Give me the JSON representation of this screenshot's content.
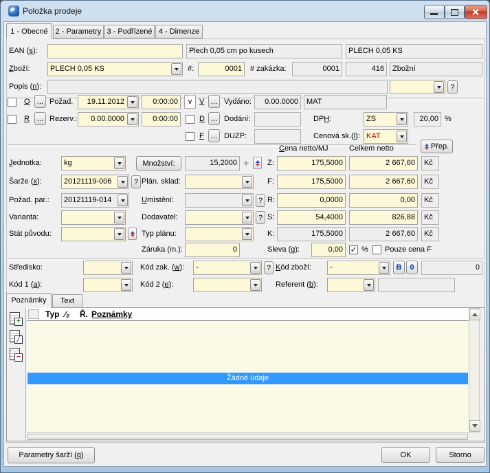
{
  "window": {
    "title": "Položka prodeje"
  },
  "colors": {
    "selection": "#3399ff",
    "alert_red": "#cc0000",
    "link_blue": "#0033aa",
    "field_yellow": "#fdf9d8"
  },
  "tabs": {
    "tab1": "1 - Obecné",
    "tab2": "2 - Parametry",
    "tab3": "3 - Podřízené",
    "tab4": "4 - Dimenze"
  },
  "misc": {
    "dots": "...",
    "question": "?",
    "plus": "+",
    "check_glyph": "✓"
  },
  "top": {
    "ean_label": "EAN (*s*):",
    "ean_value": "",
    "name_full": "Plech 0,05 cm po kusech",
    "name_code": "PLECH 0,05 KS",
    "zbozi_label": "*Z*boží:",
    "zbozi_value": "PLECH 0,05 KS",
    "hash_label": "#:",
    "hash_value": "0001",
    "zakazka_label": "# zakázka:",
    "zakazka_value": "0001",
    "zakazka_num": "416",
    "zakazka_type": "Zbožní",
    "popis_label": "Popis (*n*):",
    "popis_value": "",
    "popis_combo": ""
  },
  "dates": {
    "o_letter": "*O*",
    "o_label": "Požad.",
    "o_date": "19.11.2012",
    "o_time": "0:00:00",
    "r_letter": "*R*",
    "r_label": "Rezerv.:",
    "r_date": "0.00.0000",
    "r_time": "0:00:00",
    "v_flag": "v",
    "v_letter": "*V*",
    "v_label": "Vydáno:",
    "v_date": "0.00.0000",
    "v_extra": "MAT",
    "d_letter": "*D*",
    "d_label": "Dodání:",
    "d_date": "",
    "f_letter": "*F*",
    "f_label": "DUZP:",
    "f_date": "",
    "dph_label": "DP*H*:",
    "dph_value": "ZS",
    "dph_rate": "20,00",
    "dph_pct": "%",
    "cenova_label": "Cenová sk.(*l*):",
    "cenova_value": "KAT"
  },
  "mid": {
    "jednotka_label": "*J*ednotka:",
    "jednotka_value": "kg",
    "mnozstvi_button": "Množství:",
    "mnozstvi_value": "15,2000",
    "sarze_label": "Šarže (*x*):",
    "sarze_value": "20121119-006",
    "plansklad_label": "Plán. sklad:",
    "plansklad_value": "",
    "pozadpar_label": "Požad. par.:",
    "pozadpar_value": "20121119-014",
    "umisteni_label": "*U*místění:",
    "umisteni_value": "",
    "varianta_label": "Varianta:",
    "varianta_value": "",
    "dodavatel_label": "Dodavatel:",
    "dodavatel_value": "",
    "stat_label": "Stát původu:",
    "stat_value": "",
    "typplanu_label": "Typ plánu:",
    "typplanu_value": "",
    "zaruka_label": "Záruka (m.):",
    "zaruka_value": "0"
  },
  "prices": {
    "header_mj": "*C*ena netto/MJ",
    "header_total": "Celkem netto",
    "prep_button": "Přep.",
    "rows": [
      {
        "key": "Z:",
        "mj": "175,5000",
        "total": "2 667,60",
        "cur": "Kč"
      },
      {
        "key": "F:",
        "mj": "175,5000",
        "total": "2 667,60",
        "cur": "Kč"
      },
      {
        "key": "R:",
        "mj": "0,0000",
        "total": "0,00",
        "cur": "Kč"
      },
      {
        "key": "S:",
        "mj": "54,4000",
        "total": "826,88",
        "cur": "Kč"
      },
      {
        "key": "K:",
        "mj": "175,5000",
        "total": "2 667,60",
        "cur": "Kč"
      }
    ],
    "sleva_label": "Sleva (*g*):",
    "sleva_value": "0,00",
    "sleva_pct": "%",
    "pouze_label": "Pouze cena F"
  },
  "codes": {
    "stredisko_label": "Středisko:",
    "stredisko_value": "",
    "kodzak_label": "Kód zak. (*w*):",
    "kodzak_value": "-",
    "kodzbozi_label": "*K*ód zboží:",
    "kodzbozi_value": "-",
    "b_button": "B",
    "o_button": "0",
    "count_value": "0",
    "kod1_label": "Kód 1 (*a*):",
    "kod1_value": "",
    "kod2_label": "Kód 2 (*e*):",
    "kod2_value": "",
    "referent_label": "Referent (*b*):",
    "referent_value": "",
    "referent_extra": ""
  },
  "notes": {
    "tab_poznamky": "Poznámky",
    "tab_text": "Text",
    "col_typ": "Typ",
    "col_half": "⁄₂",
    "col_r": "Ř.",
    "col_poznamky": "*Poznámky*",
    "empty_text": "Žádné údaje",
    "toolbar": {
      "add": "+",
      "edit": "╱",
      "delete": "−"
    }
  },
  "footer": {
    "params_button": "Parametry šarží (*q*)",
    "ok_button": "OK",
    "storno_button": "Storno"
  }
}
